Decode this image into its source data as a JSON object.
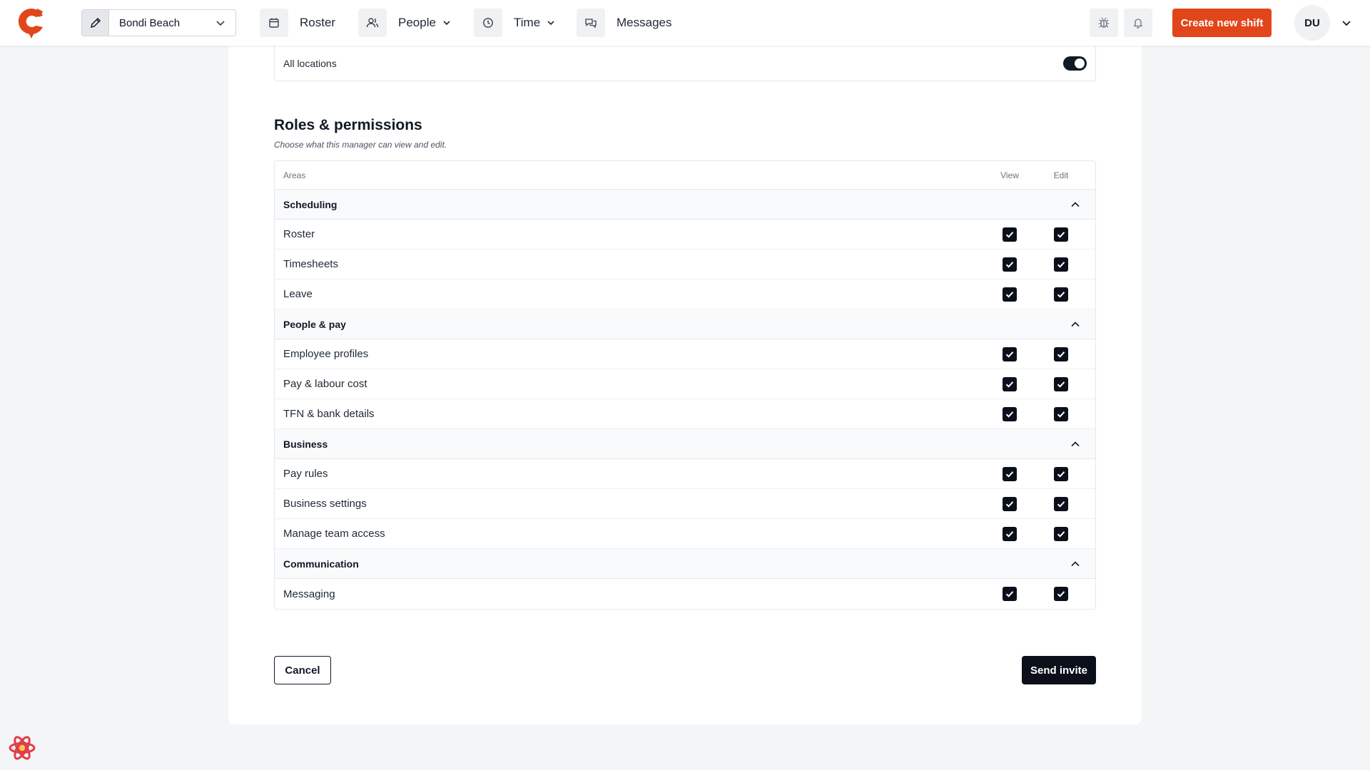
{
  "header": {
    "location_select": {
      "value": "Bondi Beach"
    },
    "nav": [
      {
        "label": "Roster",
        "icon": "calendar-icon",
        "has_dropdown": false
      },
      {
        "label": "People",
        "icon": "people-icon",
        "has_dropdown": true
      },
      {
        "label": "Time",
        "icon": "clock-icon",
        "has_dropdown": true
      },
      {
        "label": "Messages",
        "icon": "chat-icon",
        "has_dropdown": false
      }
    ],
    "create_button_label": "Create new shift",
    "avatar_initials": "DU",
    "colors": {
      "accent": "#e1461a",
      "dark": "#0b0f1a"
    }
  },
  "locations_row": {
    "label": "All locations",
    "toggle_on": true
  },
  "roles": {
    "title": "Roles & permissions",
    "subtitle": "Choose what this manager can view and edit.",
    "columns": {
      "areas": "Areas",
      "view": "View",
      "edit": "Edit"
    },
    "groups": [
      {
        "label": "Scheduling",
        "items": [
          {
            "label": "Roster",
            "view": true,
            "edit": true
          },
          {
            "label": "Timesheets",
            "view": true,
            "edit": true
          },
          {
            "label": "Leave",
            "view": true,
            "edit": true
          }
        ]
      },
      {
        "label": "People & pay",
        "items": [
          {
            "label": "Employee profiles",
            "view": true,
            "edit": true
          },
          {
            "label": "Pay & labour cost",
            "view": true,
            "edit": true
          },
          {
            "label": "TFN & bank details",
            "view": true,
            "edit": true
          }
        ]
      },
      {
        "label": "Business",
        "items": [
          {
            "label": "Pay rules",
            "view": true,
            "edit": true
          },
          {
            "label": "Business settings",
            "view": true,
            "edit": true
          },
          {
            "label": "Manage team access",
            "view": true,
            "edit": true
          }
        ]
      },
      {
        "label": "Communication",
        "items": [
          {
            "label": "Messaging",
            "view": true,
            "edit": true
          }
        ]
      }
    ]
  },
  "footer": {
    "cancel_label": "Cancel",
    "send_label": "Send invite"
  }
}
